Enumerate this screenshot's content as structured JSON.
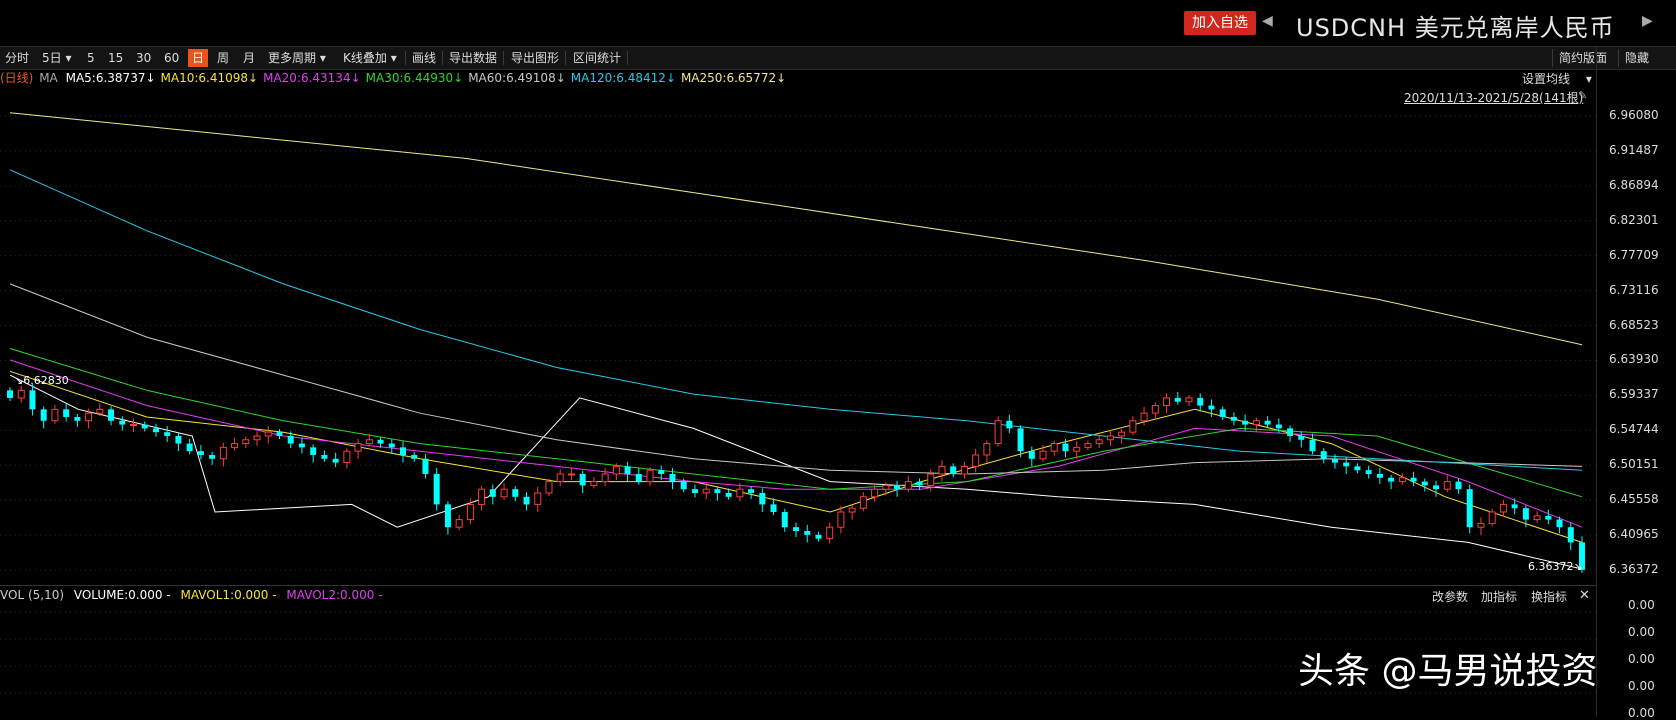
{
  "header": {
    "add_watchlist": "加入自选",
    "prev_arrow": "◀",
    "next_arrow": "▶",
    "symbol": "USDCNH",
    "name": "美元兑离岸人民币"
  },
  "toolbar": {
    "items": [
      "分时",
      "5日",
      "5",
      "15",
      "30",
      "60",
      "日",
      "周",
      "月",
      "更多周期",
      "K线叠加",
      "画线",
      "导出数据",
      "导出图形",
      "区间统计"
    ],
    "active": "日",
    "right": [
      "简约版面",
      "隐藏"
    ]
  },
  "ma_legend": {
    "prefix": "(日线)",
    "ma_label": "MA",
    "items": [
      {
        "text": "MA5:6.38737↓",
        "color": "#ffffff"
      },
      {
        "text": "MA10:6.41098↓",
        "color": "#f4e436"
      },
      {
        "text": "MA20:6.43134↓",
        "color": "#e23cf0"
      },
      {
        "text": "MA30:6.44930↓",
        "color": "#2fd42f"
      },
      {
        "text": "MA60:6.49108↓",
        "color": "#c8c8c8"
      },
      {
        "text": "MA120:6.48412↓",
        "color": "#25c9e6"
      },
      {
        "text": "MA250:6.65772↓",
        "color": "#f0e68c"
      }
    ],
    "set_ma": "设置均线",
    "range": "2020/11/13-2021/5/28(141根)"
  },
  "y_axis": [
    "6.96080",
    "6.91487",
    "6.86894",
    "6.82301",
    "6.77709",
    "6.73116",
    "6.68523",
    "6.63930",
    "6.59337",
    "6.54744",
    "6.50151",
    "6.45558",
    "6.40965",
    "6.36372"
  ],
  "price_labels": {
    "high": "6.62830",
    "low": "6.36372"
  },
  "volume": {
    "title": "VOL (5,10)",
    "volume": "VOLUME:0.000 -",
    "mavol1": "MAVOL1:0.000 -",
    "mavol2": "MAVOL2:0.000 -",
    "buttons": [
      "改参数",
      "加指标",
      "换指标"
    ],
    "close": "✕",
    "y_axis": [
      "0.00",
      "0.00",
      "0.00",
      "0.00",
      "0.00"
    ]
  },
  "watermark": "头条 @马男说投资",
  "colors": {
    "up": "#ff3b3b",
    "down": "#00ffff",
    "active": "#e8541e",
    "add_button": "#d0281e"
  },
  "chart_data": {
    "type": "candlestick",
    "period": "2020/11/13-2021/5/28",
    "ylim": [
      6.34,
      6.98
    ],
    "closes": [
      6.59,
      6.6,
      6.575,
      6.56,
      6.575,
      6.565,
      6.56,
      6.57,
      6.575,
      6.56,
      6.555,
      6.555,
      6.55,
      6.545,
      6.54,
      6.53,
      6.52,
      6.515,
      6.51,
      6.525,
      6.53,
      6.535,
      6.54,
      6.545,
      6.54,
      6.53,
      6.525,
      6.515,
      6.51,
      6.505,
      6.52,
      6.53,
      6.535,
      6.53,
      6.525,
      6.515,
      6.51,
      6.49,
      6.45,
      6.42,
      6.43,
      6.45,
      6.47,
      6.46,
      6.47,
      6.46,
      6.45,
      6.465,
      6.48,
      6.49,
      6.49,
      6.475,
      6.48,
      6.49,
      6.5,
      6.49,
      6.48,
      6.495,
      6.49,
      6.48,
      6.47,
      6.465,
      6.47,
      6.465,
      6.46,
      6.47,
      6.465,
      6.45,
      6.44,
      6.42,
      6.415,
      6.41,
      6.405,
      6.42,
      6.44,
      6.445,
      6.46,
      6.47,
      6.475,
      6.47,
      6.48,
      6.475,
      6.49,
      6.5,
      6.49,
      6.5,
      6.515,
      6.53,
      6.56,
      6.55,
      6.52,
      6.51,
      6.52,
      6.53,
      6.52,
      6.525,
      6.53,
      6.535,
      6.54,
      6.545,
      6.56,
      6.57,
      6.58,
      6.59,
      6.585,
      6.59,
      6.58,
      6.575,
      6.565,
      6.56,
      6.555,
      6.56,
      6.555,
      6.55,
      6.54,
      6.535,
      6.52,
      6.51,
      6.505,
      6.5,
      6.495,
      6.49,
      6.485,
      6.48,
      6.485,
      6.48,
      6.475,
      6.47,
      6.48,
      6.47,
      6.42,
      6.425,
      6.44,
      6.45,
      6.445,
      6.43,
      6.435,
      6.43,
      6.42,
      6.4,
      6.364
    ],
    "ma_lines": {
      "MA5": {
        "color": "#ffffff",
        "points": [
          [
            0,
            6.62
          ],
          [
            15,
            6.575
          ],
          [
            40,
            6.54
          ],
          [
            45,
            6.44
          ],
          [
            75,
            6.45
          ],
          [
            85,
            6.42
          ],
          [
            105,
            6.46
          ],
          [
            125,
            6.59
          ],
          [
            150,
            6.55
          ],
          [
            180,
            6.48
          ],
          [
            210,
            6.47
          ],
          [
            230,
            6.46
          ],
          [
            260,
            6.45
          ],
          [
            290,
            6.42
          ],
          [
            320,
            6.4
          ],
          [
            345,
            6.365
          ]
        ]
      },
      "MA10": {
        "color": "#f4e436",
        "points": [
          [
            0,
            6.625
          ],
          [
            30,
            6.565
          ],
          [
            60,
            6.545
          ],
          [
            90,
            6.51
          ],
          [
            120,
            6.48
          ],
          [
            150,
            6.48
          ],
          [
            180,
            6.44
          ],
          [
            200,
            6.48
          ],
          [
            230,
            6.53
          ],
          [
            260,
            6.575
          ],
          [
            290,
            6.53
          ],
          [
            315,
            6.46
          ],
          [
            345,
            6.4
          ]
        ]
      },
      "MA20": {
        "color": "#e23cf0",
        "points": [
          [
            0,
            6.64
          ],
          [
            30,
            6.58
          ],
          [
            60,
            6.54
          ],
          [
            90,
            6.52
          ],
          [
            120,
            6.5
          ],
          [
            150,
            6.48
          ],
          [
            170,
            6.47
          ],
          [
            200,
            6.47
          ],
          [
            230,
            6.5
          ],
          [
            260,
            6.55
          ],
          [
            290,
            6.54
          ],
          [
            320,
            6.48
          ],
          [
            345,
            6.42
          ]
        ]
      },
      "MA30": {
        "color": "#2fd42f",
        "points": [
          [
            0,
            6.655
          ],
          [
            30,
            6.6
          ],
          [
            60,
            6.56
          ],
          [
            90,
            6.53
          ],
          [
            120,
            6.51
          ],
          [
            150,
            6.49
          ],
          [
            180,
            6.47
          ],
          [
            210,
            6.48
          ],
          [
            240,
            6.52
          ],
          [
            270,
            6.55
          ],
          [
            300,
            6.54
          ],
          [
            345,
            6.46
          ]
        ]
      },
      "MA60": {
        "color": "#c8c8c8",
        "points": [
          [
            0,
            6.74
          ],
          [
            30,
            6.67
          ],
          [
            60,
            6.62
          ],
          [
            90,
            6.57
          ],
          [
            120,
            6.535
          ],
          [
            150,
            6.51
          ],
          [
            180,
            6.495
          ],
          [
            210,
            6.49
          ],
          [
            240,
            6.495
          ],
          [
            260,
            6.505
          ],
          [
            290,
            6.51
          ],
          [
            345,
            6.5
          ]
        ]
      },
      "MA120": {
        "color": "#25c9e6",
        "points": [
          [
            0,
            6.89
          ],
          [
            30,
            6.81
          ],
          [
            60,
            6.74
          ],
          [
            90,
            6.68
          ],
          [
            120,
            6.63
          ],
          [
            150,
            6.595
          ],
          [
            180,
            6.575
          ],
          [
            210,
            6.56
          ],
          [
            240,
            6.54
          ],
          [
            270,
            6.52
          ],
          [
            300,
            6.51
          ],
          [
            345,
            6.495
          ]
        ]
      },
      "MA250": {
        "color": "#f0e68c",
        "points": [
          [
            0,
            6.965
          ],
          [
            50,
            6.935
          ],
          [
            100,
            6.905
          ],
          [
            150,
            6.86
          ],
          [
            200,
            6.815
          ],
          [
            250,
            6.77
          ],
          [
            300,
            6.72
          ],
          [
            345,
            6.66
          ]
        ]
      }
    }
  }
}
